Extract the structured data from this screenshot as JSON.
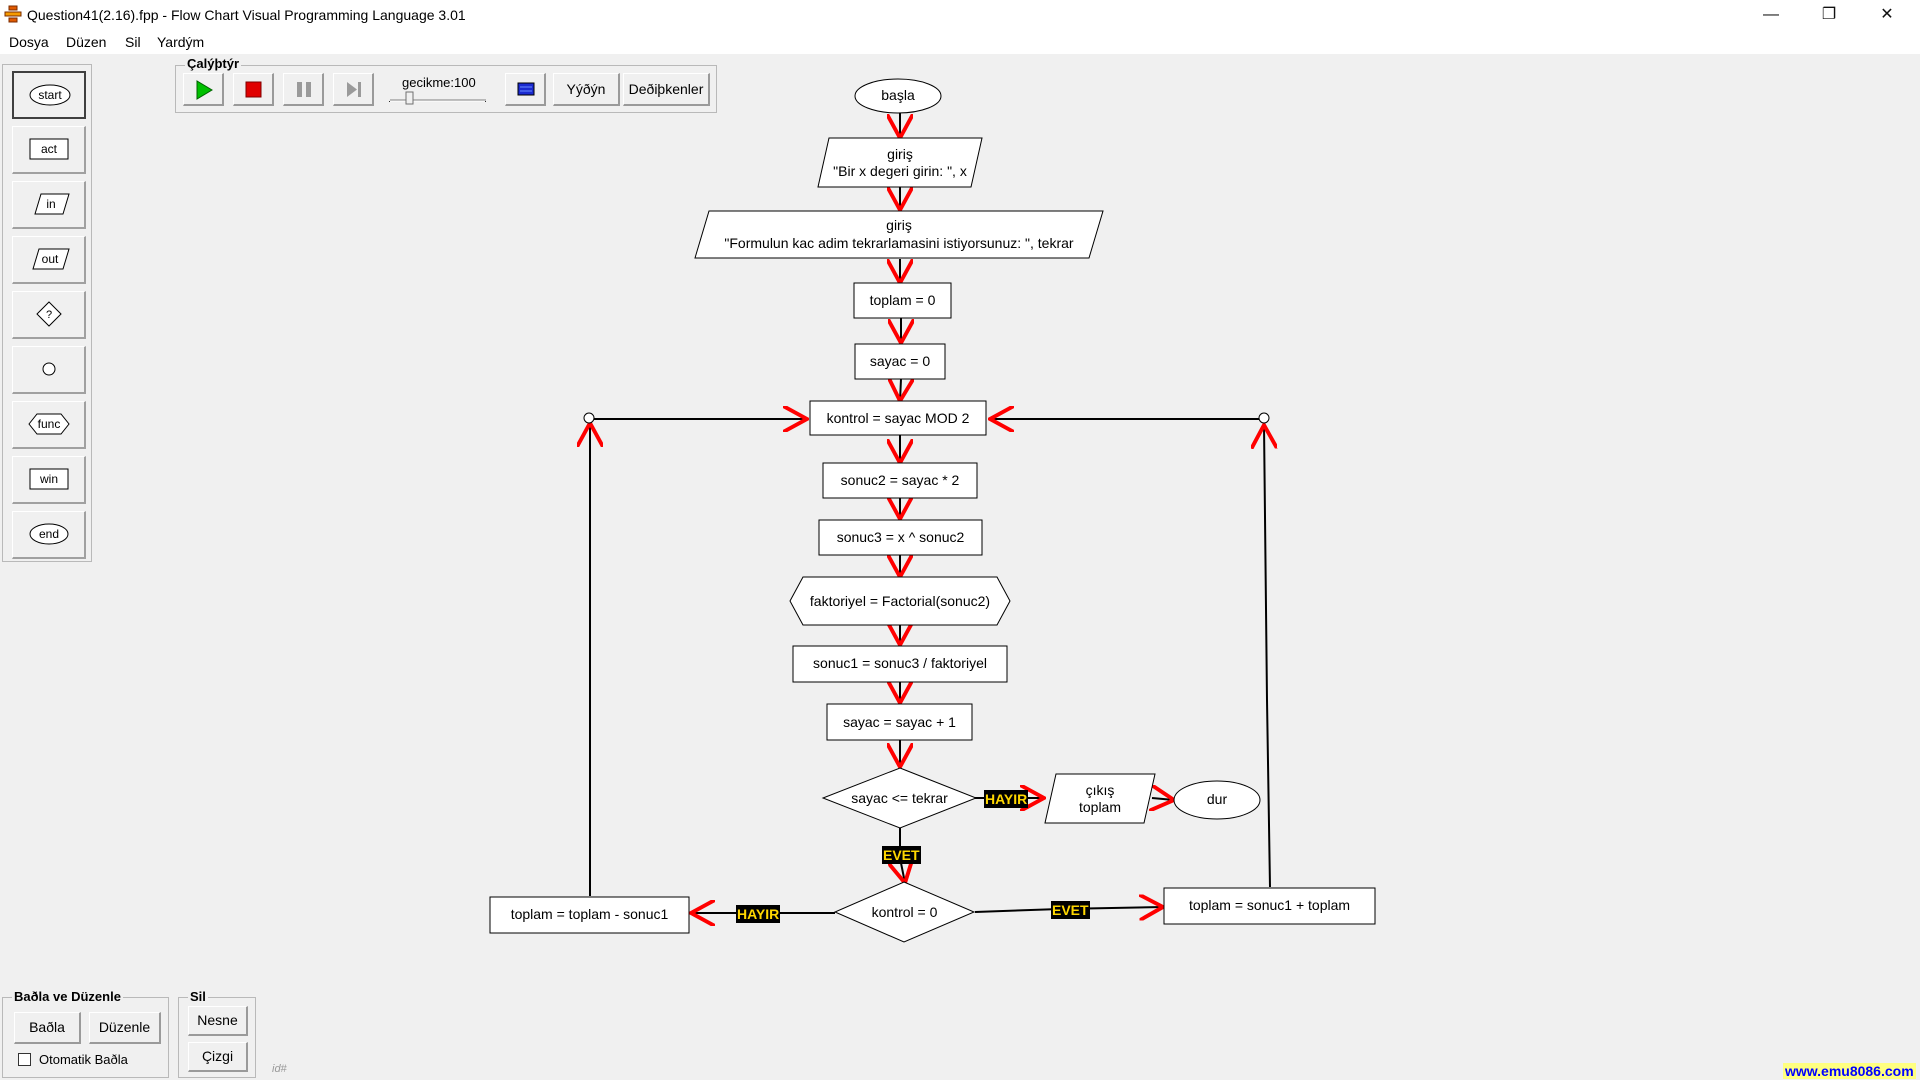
{
  "window": {
    "title": "Question41(2.16).fpp - Flow Chart Visual Programming Language 3.01",
    "controls": {
      "minimize": "—",
      "maximize": "❐",
      "close": "✕"
    }
  },
  "menu": [
    "Dosya",
    "Düzen",
    "Sil",
    "Yardým"
  ],
  "palette": [
    "start",
    "act",
    "in",
    "out",
    "?",
    "",
    "func",
    "win",
    "end"
  ],
  "toolbar": {
    "group_label": "Çalýþtýr",
    "delay_label": "gecikme:100",
    "delay_value": 100,
    "output_button": "Yýðýn",
    "variables_button": "Deðiþkenler"
  },
  "flowchart": {
    "start": "başla",
    "input1": [
      "giriş",
      "\"Bir x degeri girin: \", x"
    ],
    "input2": [
      "giriş",
      "\"Formulun kac adim tekrarlamasini istiyorsunuz: \", tekrar"
    ],
    "act1": "toplam = 0",
    "act2": "sayac = 0",
    "act3": "kontrol = sayac MOD 2",
    "act4": "sonuc2 = sayac * 2",
    "act5": "sonuc3 = x ^ sonuc2",
    "func1": "faktoriyel = Factorial(sonuc2)",
    "act6": "sonuc1 = sonuc3 / faktoriyel",
    "act7": "sayac = sayac + 1",
    "decision1": "sayac <= tekrar",
    "output1": [
      "çıkış",
      "toplam"
    ],
    "end": "dur",
    "decision2": "kontrol = 0",
    "act_left": "toplam = toplam - sonuc1",
    "act_right": "toplam = sonuc1 + toplam",
    "labels": {
      "no1": "HAYIR",
      "yes1": "EVET",
      "no2": "HAYIR",
      "yes2": "EVET"
    }
  },
  "bottom": {
    "connect_group": "Baðla ve Düzenle",
    "connect_button": "Baðla",
    "arrange_button": "Düzenle",
    "auto_connect": "Otomatik Baðla",
    "delete_group": "Sil",
    "object_button": "Nesne",
    "line_button": "Çizgi",
    "id_label": "id#",
    "footer": "www.emu8086.com"
  },
  "colors": {
    "arrow": "#ff0000",
    "tag_bg": "#000000",
    "tag_fg": "#ffd700"
  }
}
